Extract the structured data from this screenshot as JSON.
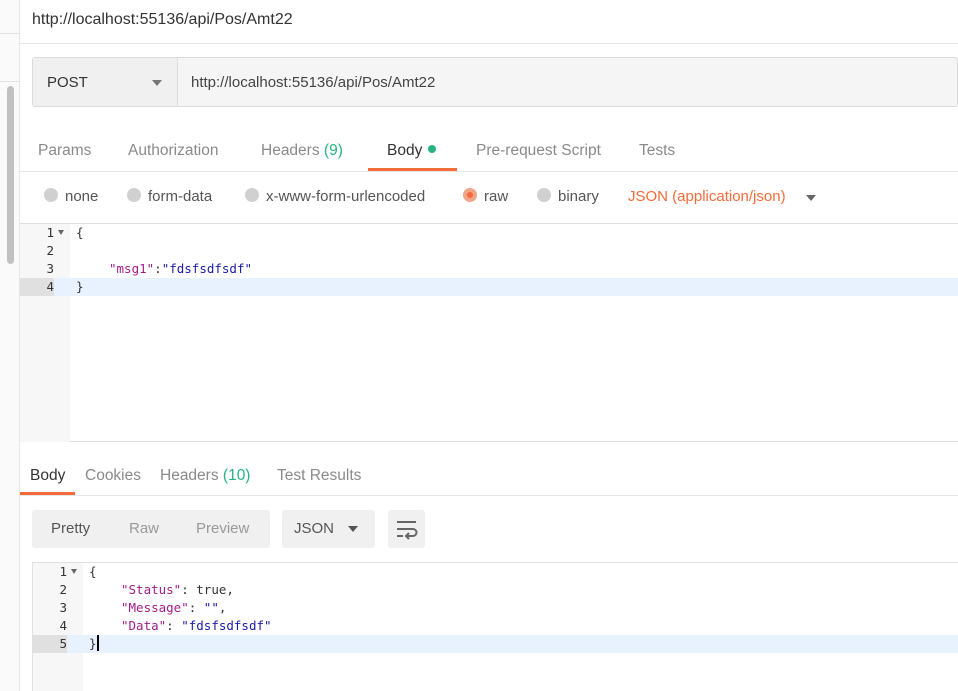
{
  "title": "http://localhost:55136/api/Pos/Amt22",
  "request": {
    "method": "POST",
    "url": "http://localhost:55136/api/Pos/Amt22"
  },
  "request_tabs": [
    {
      "label": "Params"
    },
    {
      "label": "Authorization"
    },
    {
      "label": "Headers",
      "count": "(9)"
    },
    {
      "label": "Body"
    },
    {
      "label": "Pre-request Script"
    },
    {
      "label": "Tests"
    }
  ],
  "body_types": [
    {
      "label": "none"
    },
    {
      "label": "form-data"
    },
    {
      "label": "x-www-form-urlencoded"
    },
    {
      "label": "raw"
    },
    {
      "label": "binary"
    }
  ],
  "content_type": "JSON (application/json)",
  "request_body": {
    "line_numbers": [
      "1",
      "2",
      "3",
      "4"
    ],
    "brace_open": "{",
    "brace_close": "}",
    "key": "\"msg1\"",
    "colon": ":",
    "value": "\"fdsfsdfsdf\""
  },
  "response_tabs": [
    {
      "label": "Body"
    },
    {
      "label": "Cookies"
    },
    {
      "label": "Headers",
      "count": "(10)"
    },
    {
      "label": "Test Results"
    }
  ],
  "view_modes": [
    "Pretty",
    "Raw",
    "Preview"
  ],
  "format": "JSON",
  "response_body": {
    "line_numbers": [
      "1",
      "2",
      "3",
      "4",
      "5"
    ],
    "brace_open": "{",
    "brace_close": "}",
    "status_key": "\"Status\"",
    "status_value": "true",
    "message_key": "\"Message\"",
    "message_value": "\"\"",
    "data_key": "\"Data\"",
    "data_value": "\"fdsfsdfsdf\""
  },
  "colors": {
    "accent": "#f26b3a",
    "count_green": "#26b47f"
  }
}
